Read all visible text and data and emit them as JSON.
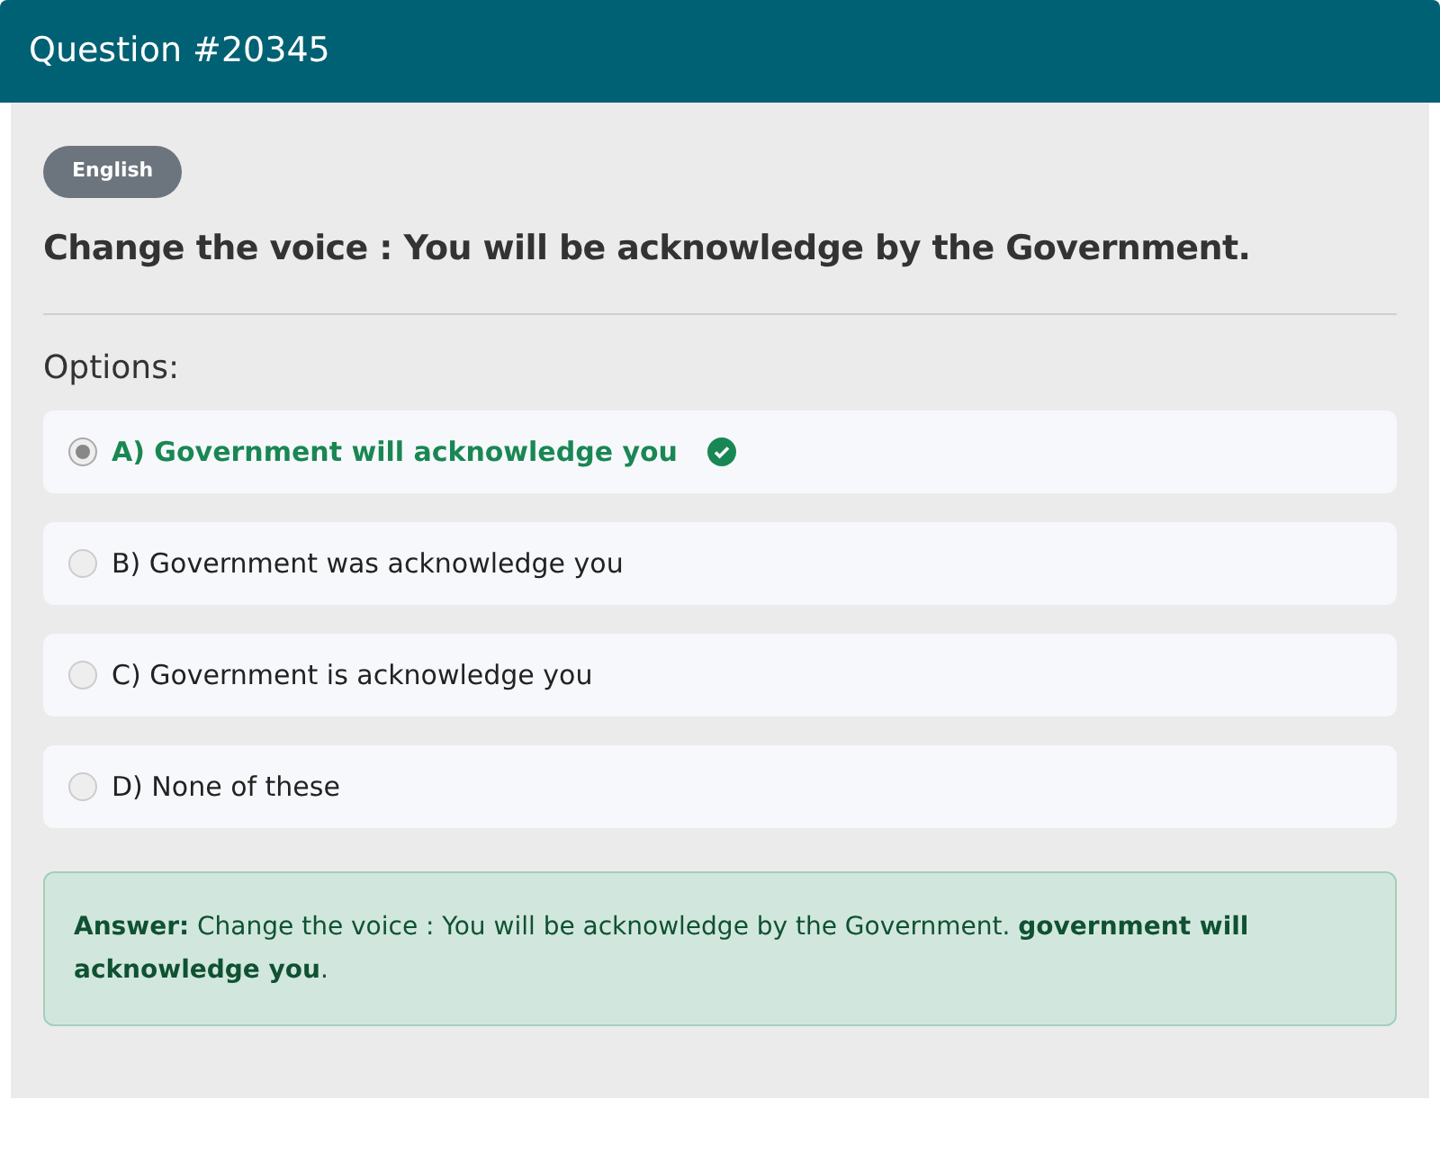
{
  "header": {
    "title": "Question #20345"
  },
  "subject_badge": "English",
  "question": "Change the voice : You will be acknowledge by the Government.",
  "options_label": "Options:",
  "options": [
    {
      "label": "A) Government will acknowledge you",
      "selected": true,
      "correct": true
    },
    {
      "label": "B) Government was acknowledge you",
      "selected": false,
      "correct": false
    },
    {
      "label": "C) Government is acknowledge you",
      "selected": false,
      "correct": false
    },
    {
      "label": "D) None of these",
      "selected": false,
      "correct": false
    }
  ],
  "answer": "**Answer:** Change the voice : You will be acknowledge by the Government. **government will acknowledge you**."
}
